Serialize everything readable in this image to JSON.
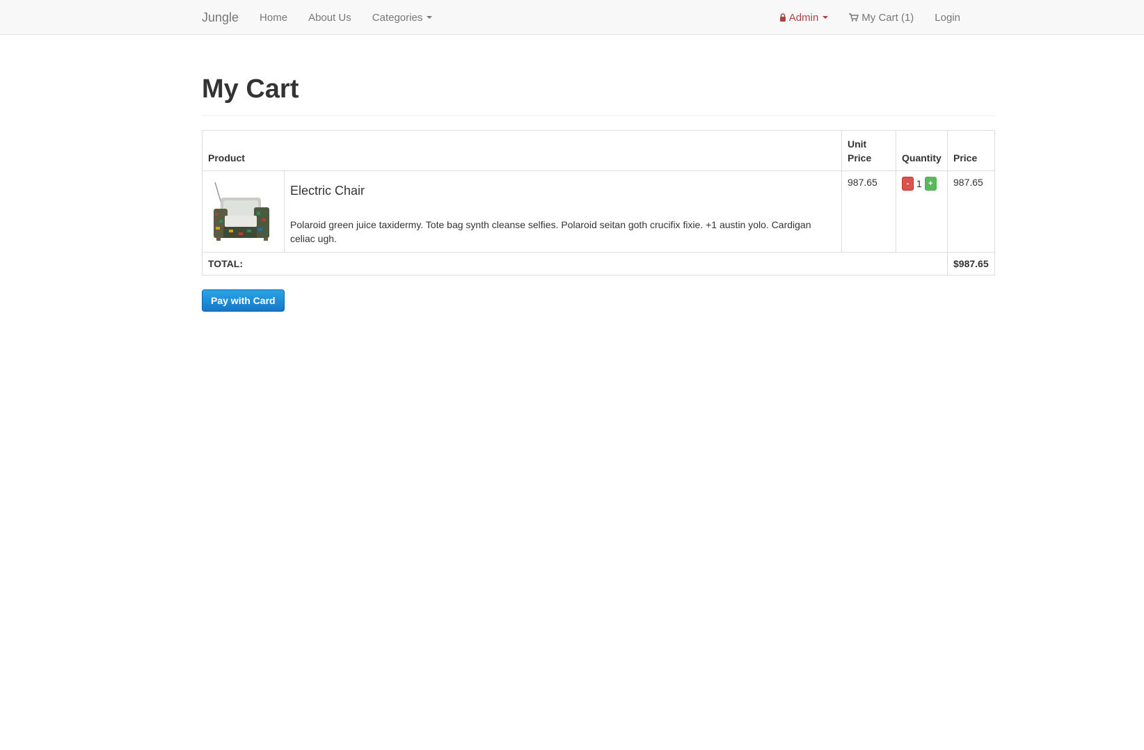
{
  "nav": {
    "brand": "Jungle",
    "home": "Home",
    "about": "About Us",
    "categories": "Categories",
    "admin": "Admin",
    "cart": "My Cart (1)",
    "login": "Login"
  },
  "page": {
    "title": "My Cart"
  },
  "table": {
    "headers": {
      "product": "Product",
      "unit_price": "Unit Price",
      "quantity": "Quantity",
      "price": "Price"
    },
    "items": [
      {
        "name": "Electric Chair",
        "description": "Polaroid green juice taxidermy. Tote bag synth cleanse selfies. Polaroid seitan goth crucifix fixie. +1 austin yolo. Cardigan celiac ugh.",
        "unit_price": "987.65",
        "quantity": "1",
        "minus": "-",
        "plus": "+",
        "price": "987.65"
      }
    ],
    "total_label": "TOTAL:",
    "total_value": "$987.65"
  },
  "pay_button": "Pay with Card",
  "colors": {
    "admin": "#a94442",
    "minus": "#d9534f",
    "plus": "#5cb85c",
    "pay": "#1e8bd6"
  }
}
